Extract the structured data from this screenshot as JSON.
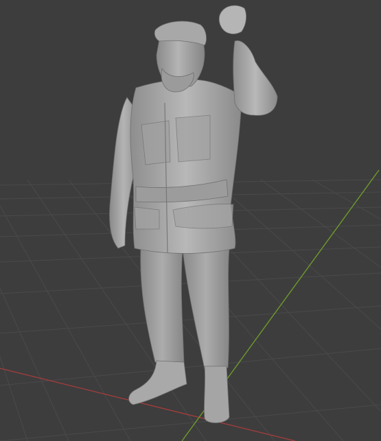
{
  "viewport": {
    "background_color": "#3d3d3d",
    "grid_color": "#4a4a4a",
    "x_axis_color": "#a23c3c",
    "y_axis_color": "#6e9a2c",
    "object_color": "#9f9f9f"
  }
}
